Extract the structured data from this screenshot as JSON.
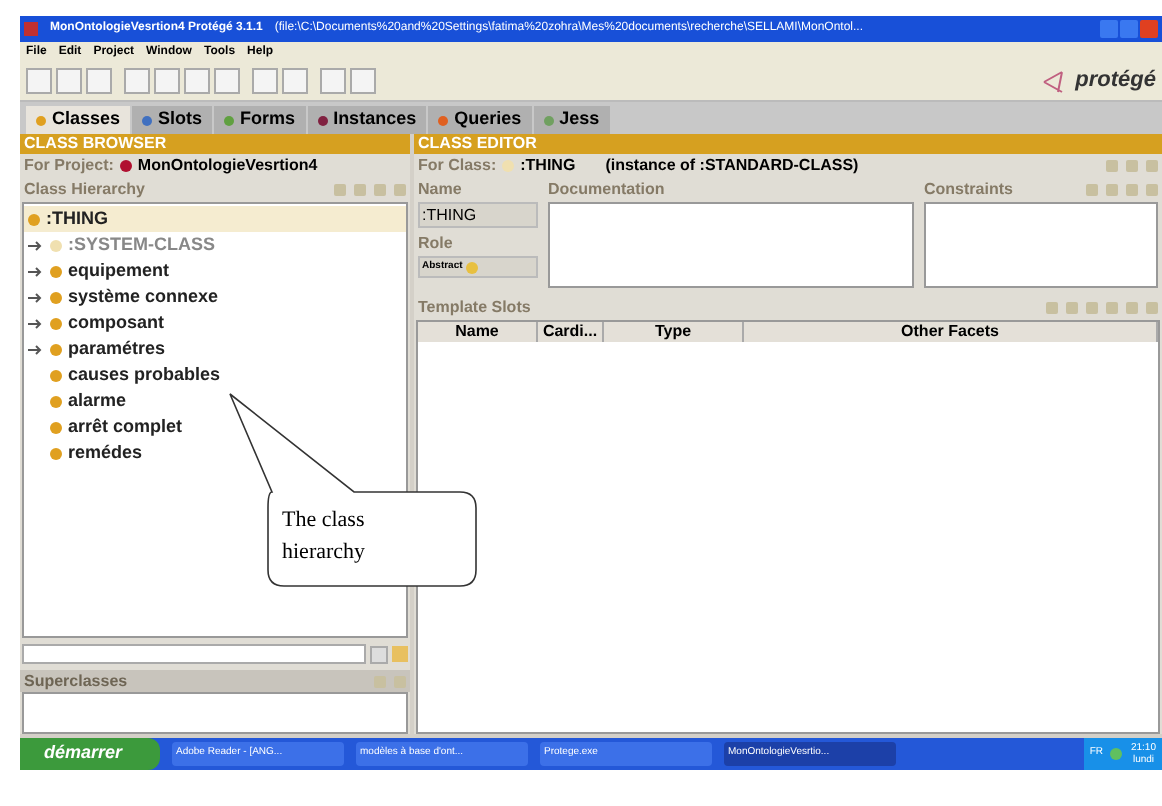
{
  "window": {
    "title": "MonOntologieVesrtion4  Protégé 3.1.1",
    "path": "(file:\\C:\\Documents%20and%20Settings\\fatima%20zohra\\Mes%20documents\\recherche\\SELLAMI\\MonOntol..."
  },
  "menu": [
    "File",
    "Edit",
    "Project",
    "Window",
    "Tools",
    "Help"
  ],
  "logo": "protégé",
  "tabs": [
    {
      "label": "Classes",
      "selected": true,
      "color": "#e0a020"
    },
    {
      "label": "Slots",
      "selected": false,
      "color": "#4070c0"
    },
    {
      "label": "Forms",
      "selected": false,
      "color": "#60a040"
    },
    {
      "label": "Instances",
      "selected": false,
      "color": "#802040"
    },
    {
      "label": "Queries",
      "selected": false,
      "color": "#e06020"
    },
    {
      "label": "Jess",
      "selected": false,
      "color": "#70a060"
    }
  ],
  "class_browser": {
    "title": "CLASS BROWSER",
    "project_label": "For Project:",
    "project": "MonOntologieVesrtion4",
    "hierarchy_label": "Class Hierarchy",
    "tree": [
      {
        "label": ":THING",
        "selected": true,
        "system": false,
        "children": [
          {
            "label": ":SYSTEM-CLASS",
            "selected": false,
            "system": true,
            "expandable": true
          },
          {
            "label": "equipement",
            "selected": false,
            "system": false,
            "expandable": true
          },
          {
            "label": "système connexe",
            "selected": false,
            "system": false,
            "expandable": true
          },
          {
            "label": "composant",
            "selected": false,
            "system": false,
            "expandable": true
          },
          {
            "label": "paramétres",
            "selected": false,
            "system": false,
            "expandable": true
          },
          {
            "label": "causes probables",
            "selected": false,
            "system": false,
            "expandable": false
          },
          {
            "label": "alarme",
            "selected": false,
            "system": false,
            "expandable": false
          },
          {
            "label": "arrêt complet",
            "selected": false,
            "system": false,
            "expandable": false
          },
          {
            "label": "remédes",
            "selected": false,
            "system": false,
            "expandable": false
          }
        ]
      }
    ],
    "superclasses_label": "Superclasses"
  },
  "class_editor": {
    "title": "CLASS EDITOR",
    "for_class_label": "For Class:",
    "class_name": ":THING",
    "instance_of": "(instance of :STANDARD-CLASS)",
    "name_label": "Name",
    "name_value": ":THING",
    "documentation_label": "Documentation",
    "constraints_label": "Constraints",
    "role_label": "Role",
    "role_value": "Abstract",
    "template_slots_label": "Template Slots",
    "columns": [
      "Name",
      "Cardi...",
      "Type",
      "Other Facets"
    ]
  },
  "callout": {
    "text": "The class hierarchy"
  },
  "taskbar": {
    "start": "démarrer",
    "items": [
      "Adobe Reader - [ANG...",
      "modèles à base d'ont...",
      "Protege.exe",
      "MonOntologieVesrtio..."
    ],
    "language": "FR",
    "time": "21:10",
    "day": "lundi"
  }
}
